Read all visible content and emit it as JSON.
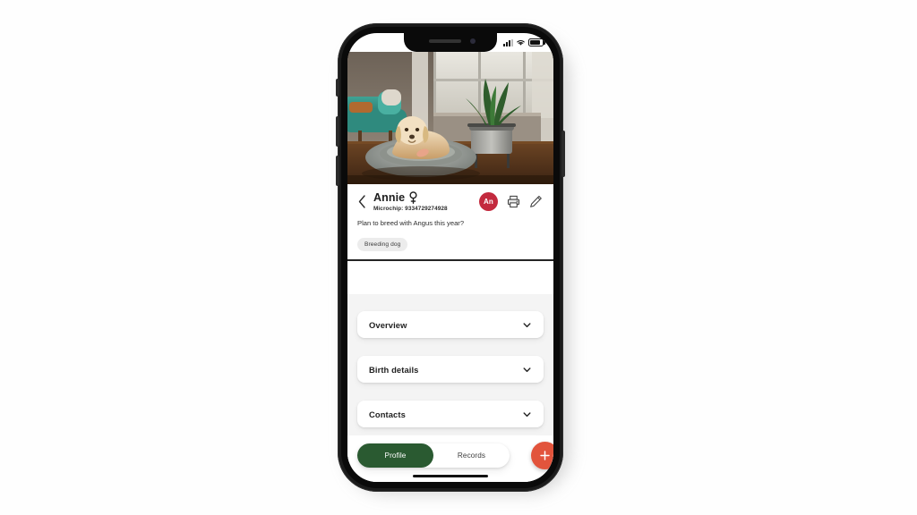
{
  "device": {
    "name": "smartphone-mockup",
    "statusbar": {
      "signal_icon": "cellular-signal-icon",
      "wifi_icon": "wifi-icon",
      "battery_icon": "battery-icon"
    },
    "buttons": {
      "silent_switch": "silent-switch",
      "volume_up": "volume-up-button",
      "volume_down": "volume-down-button",
      "power": "power-button"
    }
  },
  "hero": {
    "alt": "Golden retriever dog lying on a grey fluffy round pet bed in a living room with a teal sofa and a potted snake plant"
  },
  "header": {
    "back_icon": "back-chevron-icon",
    "pet_name": "Annie",
    "sex_icon": "female-symbol-icon",
    "microchip": "Microchip: 9334729274928",
    "avatar_initials": "An",
    "avatar_color": "#c32a3e",
    "print_icon": "printer-icon",
    "edit_icon": "pencil-icon",
    "note": "Plan to breed with Angus this year?",
    "tags": [
      "Breeding dog"
    ]
  },
  "sections": [
    {
      "label": "Overview",
      "chevron": "chevron-down-icon"
    },
    {
      "label": "Birth details",
      "chevron": "chevron-down-icon"
    },
    {
      "label": "Contacts",
      "chevron": "chevron-down-icon"
    }
  ],
  "bottom_nav": {
    "tabs": [
      {
        "label": "Profile",
        "active": true
      },
      {
        "label": "Records",
        "active": false
      }
    ],
    "fab": {
      "icon": "plus-icon",
      "color": "#e2543c"
    },
    "active_color": "#2a5a31"
  }
}
